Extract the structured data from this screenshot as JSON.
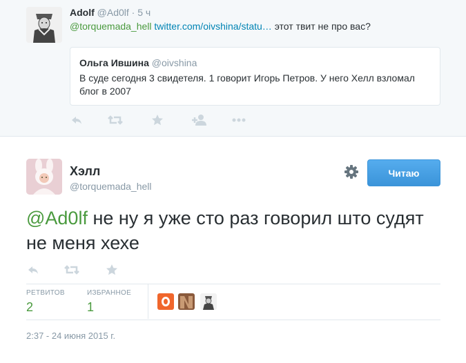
{
  "parent_tweet": {
    "author_name": "Adolf",
    "author_handle": "@Ad0lf",
    "separator": "·",
    "time": "5 ч",
    "mention": "@torquemada_hell",
    "link": "twitter.com/oivshina/statu…",
    "text": "этот твит не про вас?",
    "quoted": {
      "author_name": "Ольга Ившина",
      "author_handle": "@oivshina",
      "text": "В суде сегодня 3 свидетеля. 1 говорит Игорь Петров. У него Хелл взломал блог в 2007"
    },
    "actions": [
      "reply-icon",
      "retweet-icon",
      "favorite-icon",
      "follow-icon",
      "more-icon"
    ]
  },
  "main_tweet": {
    "author_name": "Хэлл",
    "author_handle": "@torquemada_hell",
    "follow_button": "Читаю",
    "settings_icon": "gear-icon",
    "mention": "@Ad0lf",
    "text": " не ну я уже сто раз говорил што судят не меня хехе",
    "actions": [
      "reply-icon",
      "retweet-icon",
      "favorite-icon"
    ],
    "stats": {
      "retweets_label": "РЕТВИТОВ",
      "retweets_value": "2",
      "favorites_label": "ИЗБРАННОЕ",
      "favorites_value": "1"
    },
    "favorited_by": [
      "orange-avatar",
      "brown-avatar",
      "knight-avatar"
    ],
    "timestamp": "2:37 - 24 июня 2015 г."
  },
  "colors": {
    "mention": "#4a9a3e",
    "link": "#0084b4",
    "meta_gray": "#8899a6",
    "text": "#292f33",
    "button_blue": "#55acee",
    "parent_bg": "#f5f8fa",
    "border": "#e1e8ed"
  }
}
